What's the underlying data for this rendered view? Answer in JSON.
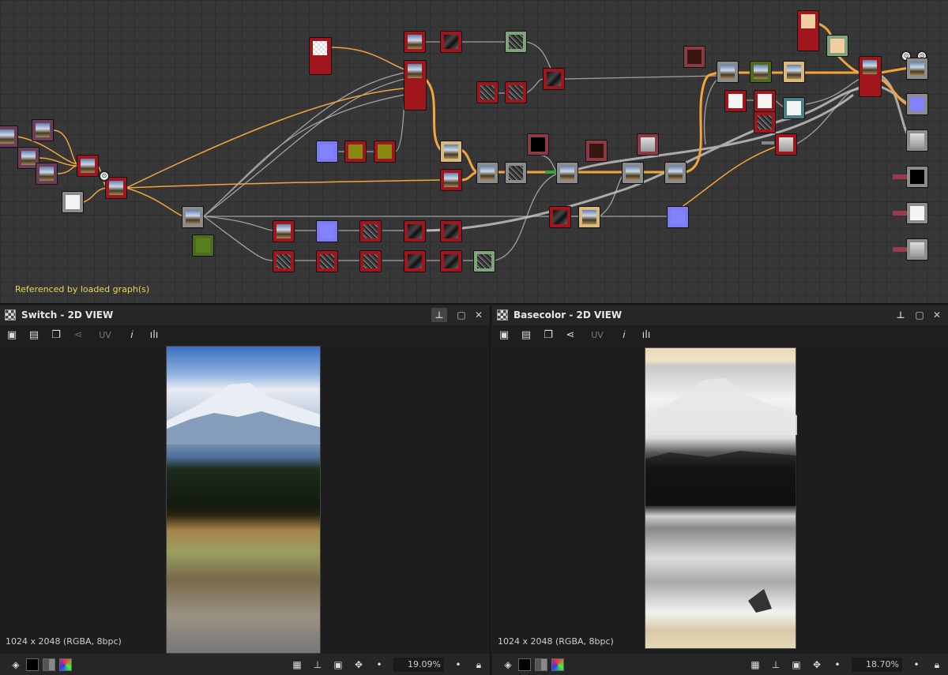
{
  "graph": {
    "label": "Referenced by loaded graph(s)",
    "badges": [
      "⊙",
      "⊙",
      "⊙"
    ]
  },
  "panels": [
    {
      "title": "Switch - 2D VIEW",
      "uv_label": "UV",
      "image_info": "1024 x 2048 (RGBA, 8bpc)",
      "zoom": "19.09%",
      "pin_icon": "pin-icon",
      "image": "mountain-photo"
    },
    {
      "title": "Basecolor - 2D VIEW",
      "uv_label": "UV",
      "image_info": "1024 x 2048 (RGBA, 8bpc)",
      "zoom": "18.70%",
      "pin_icon": "pin-icon",
      "image": "mountain-basecolor-grayscale"
    }
  ],
  "colors": {
    "background": "#1e1e1e",
    "graph_bg": "#373737",
    "label_yellow": "#e7d95a",
    "wire_orange": "#f3a53c",
    "wire_gray": "#b4b4b4",
    "node_red": "#a0161c"
  }
}
